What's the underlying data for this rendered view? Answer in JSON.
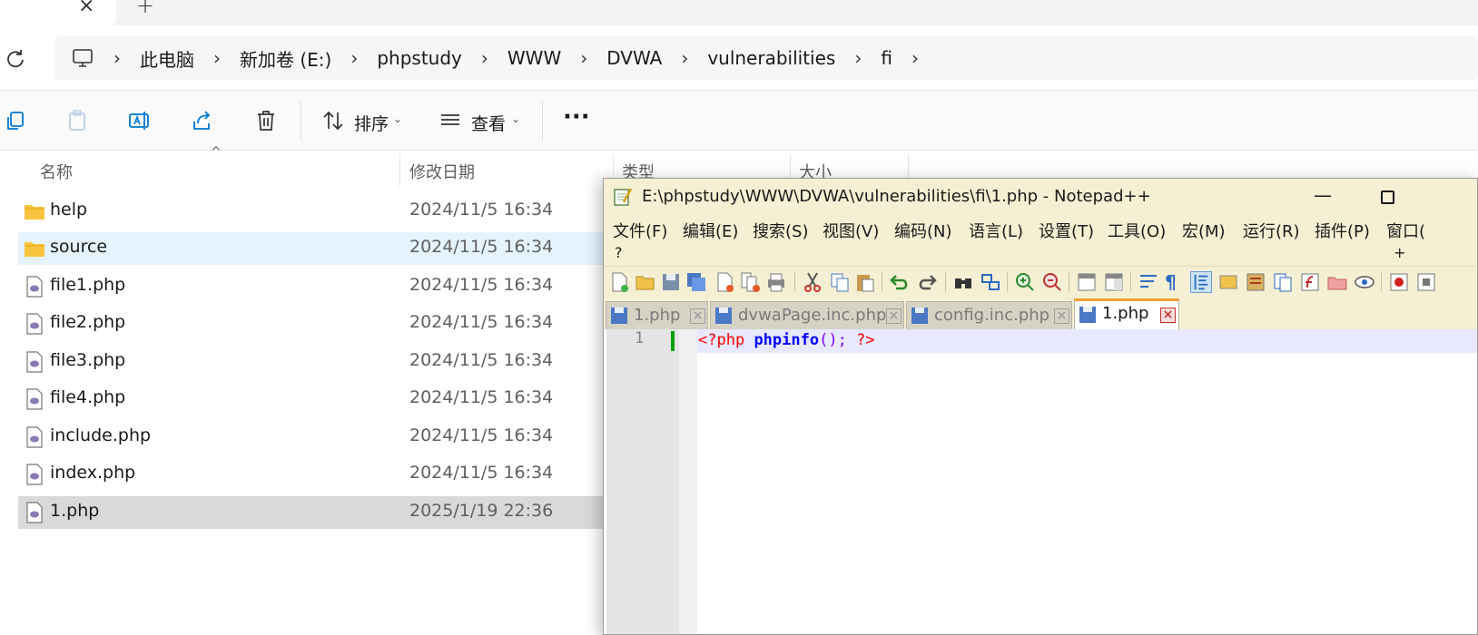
{
  "explorer": {
    "breadcrumb": [
      "此电脑",
      "新加卷 (E:)",
      "phpstudy",
      "WWW",
      "DVWA",
      "vulnerabilities",
      "fi"
    ],
    "toolbar": {
      "sort_label": "排序",
      "view_label": "查看",
      "more_label": "···"
    },
    "columns": {
      "name": "名称",
      "date": "修改日期",
      "type": "类型",
      "size": "大小"
    },
    "files": [
      {
        "name": "help",
        "date": "2024/11/5 16:34",
        "kind": "folder"
      },
      {
        "name": "source",
        "date": "2024/11/5 16:34",
        "kind": "folder"
      },
      {
        "name": "file1.php",
        "date": "2024/11/5 16:34",
        "kind": "php"
      },
      {
        "name": "file2.php",
        "date": "2024/11/5 16:34",
        "kind": "php"
      },
      {
        "name": "file3.php",
        "date": "2024/11/5 16:34",
        "kind": "php"
      },
      {
        "name": "file4.php",
        "date": "2024/11/5 16:34",
        "kind": "php"
      },
      {
        "name": "include.php",
        "date": "2024/11/5 16:34",
        "kind": "php"
      },
      {
        "name": "index.php",
        "date": "2024/11/5 16:34",
        "kind": "php"
      },
      {
        "name": "1.php",
        "date": "2025/1/19 22:36",
        "kind": "php"
      }
    ]
  },
  "npp": {
    "title": "E:\\phpstudy\\WWW\\DVWA\\vulnerabilities\\fi\\1.php - Notepad++",
    "menu": [
      "文件(F)",
      "编辑(E)",
      "搜索(S)",
      "视图(V)",
      "编码(N)",
      "语言(L)",
      "设置(T)",
      "工具(O)",
      "宏(M)",
      "运行(R)",
      "插件(P)",
      "窗口("
    ],
    "menu_extra": {
      "help": "?",
      "plus": "+"
    },
    "tabs": [
      {
        "label": "1.php",
        "active": false
      },
      {
        "label": "dvwaPage.inc.php",
        "active": false
      },
      {
        "label": "config.inc.php",
        "active": false
      },
      {
        "label": "1.php",
        "active": true
      }
    ],
    "editor": {
      "line_number": "1",
      "tokens": {
        "open": "<?php",
        "fn": "phpinfo",
        "args": "();",
        "close": "?>"
      }
    }
  },
  "colors": {
    "accent_blue": "#0078d4",
    "npp_bg": "#f5f0d3",
    "active_tab_orange": "#f7a034",
    "selection": "#d9d9d9"
  }
}
